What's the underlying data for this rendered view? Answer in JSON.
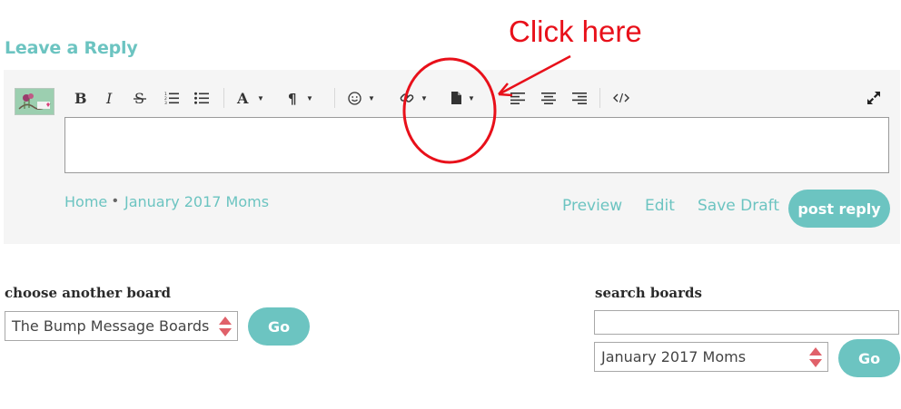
{
  "reply": {
    "heading": "Leave a Reply"
  },
  "annotation": {
    "text": "Click here",
    "color": "#e8101a"
  },
  "toolbar": {
    "buttons": [
      {
        "icon": "bold-icon"
      },
      {
        "icon": "italic-icon"
      },
      {
        "icon": "strikethrough-icon"
      },
      {
        "icon": "ordered-list-icon"
      },
      {
        "icon": "unordered-list-icon"
      },
      {
        "icon": "font-color-icon"
      },
      {
        "icon": "paragraph-icon"
      },
      {
        "icon": "emoji-icon"
      },
      {
        "icon": "link-icon"
      },
      {
        "icon": "file-icon"
      },
      {
        "icon": "align-left-icon"
      },
      {
        "icon": "align-center-icon"
      },
      {
        "icon": "align-right-icon"
      },
      {
        "icon": "code-view-icon"
      },
      {
        "icon": "fullscreen-icon"
      }
    ]
  },
  "breadcrumb": {
    "home": "Home",
    "separator": "•",
    "board": "January 2017 Moms"
  },
  "actions": {
    "preview": "Preview",
    "edit": "Edit",
    "save_draft": "Save Draft",
    "post_reply": "post reply"
  },
  "choose_board": {
    "label": "choose another board",
    "selected": "The Bump Message Boards",
    "go": "Go"
  },
  "search_boards": {
    "label": "search boards",
    "query": "",
    "selected": "January 2017 Moms",
    "go": "Go"
  },
  "colors": {
    "accent": "#6cc4c1",
    "panel_bg": "#f5f5f5",
    "select_arrows": "#e0616a"
  }
}
